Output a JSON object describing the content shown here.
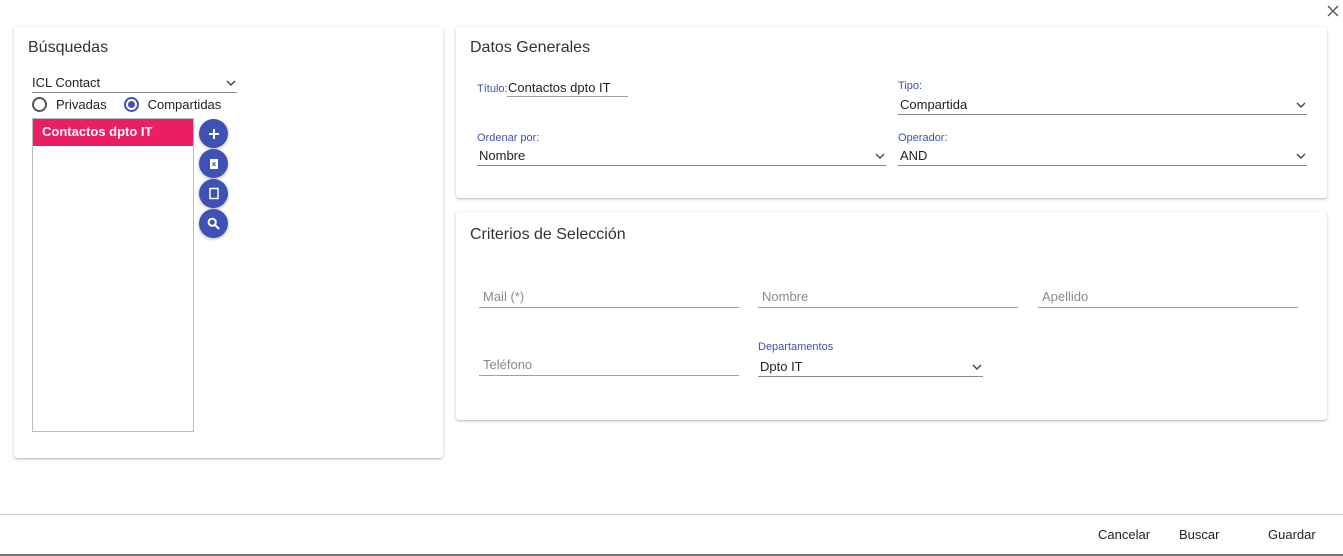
{
  "busquedas": {
    "title": "Búsquedas",
    "source_select": "ICL Contact",
    "radios": [
      {
        "label": "Privadas",
        "checked": false
      },
      {
        "label": "Compartidas",
        "checked": true
      }
    ],
    "list_items": [
      "Contactos dpto IT"
    ],
    "list_selected_color": "#e91e63",
    "fab_color": "#3f51b5"
  },
  "datos_generales": {
    "title": "Datos Generales",
    "titulo_label": "Título:",
    "titulo_value": "Contactos dpto IT",
    "tipo_label": "Tipo:",
    "tipo_value": "Compartida",
    "ordenar_label": "Ordenar por:",
    "ordenar_value": "Nombre",
    "operador_label": "Operador:",
    "operador_value": "AND"
  },
  "criterios": {
    "title": "Criterios de Selección",
    "mail_placeholder": "Mail (*)",
    "nombre_placeholder": "Nombre",
    "apellido_placeholder": "Apellido",
    "telefono_placeholder": "Teléfono",
    "departamentos_label": "Departamentos",
    "departamentos_value": "Dpto IT"
  },
  "footer": {
    "cancel": "Cancelar",
    "search": "Buscar",
    "save": "Guardar"
  },
  "icons": {
    "close": "close-icon",
    "chevron": "chevron-down-icon",
    "add": "plus-icon",
    "delete": "trash-icon",
    "copy": "copy-icon",
    "search": "search-icon"
  },
  "accent_color": "#3f51b5"
}
